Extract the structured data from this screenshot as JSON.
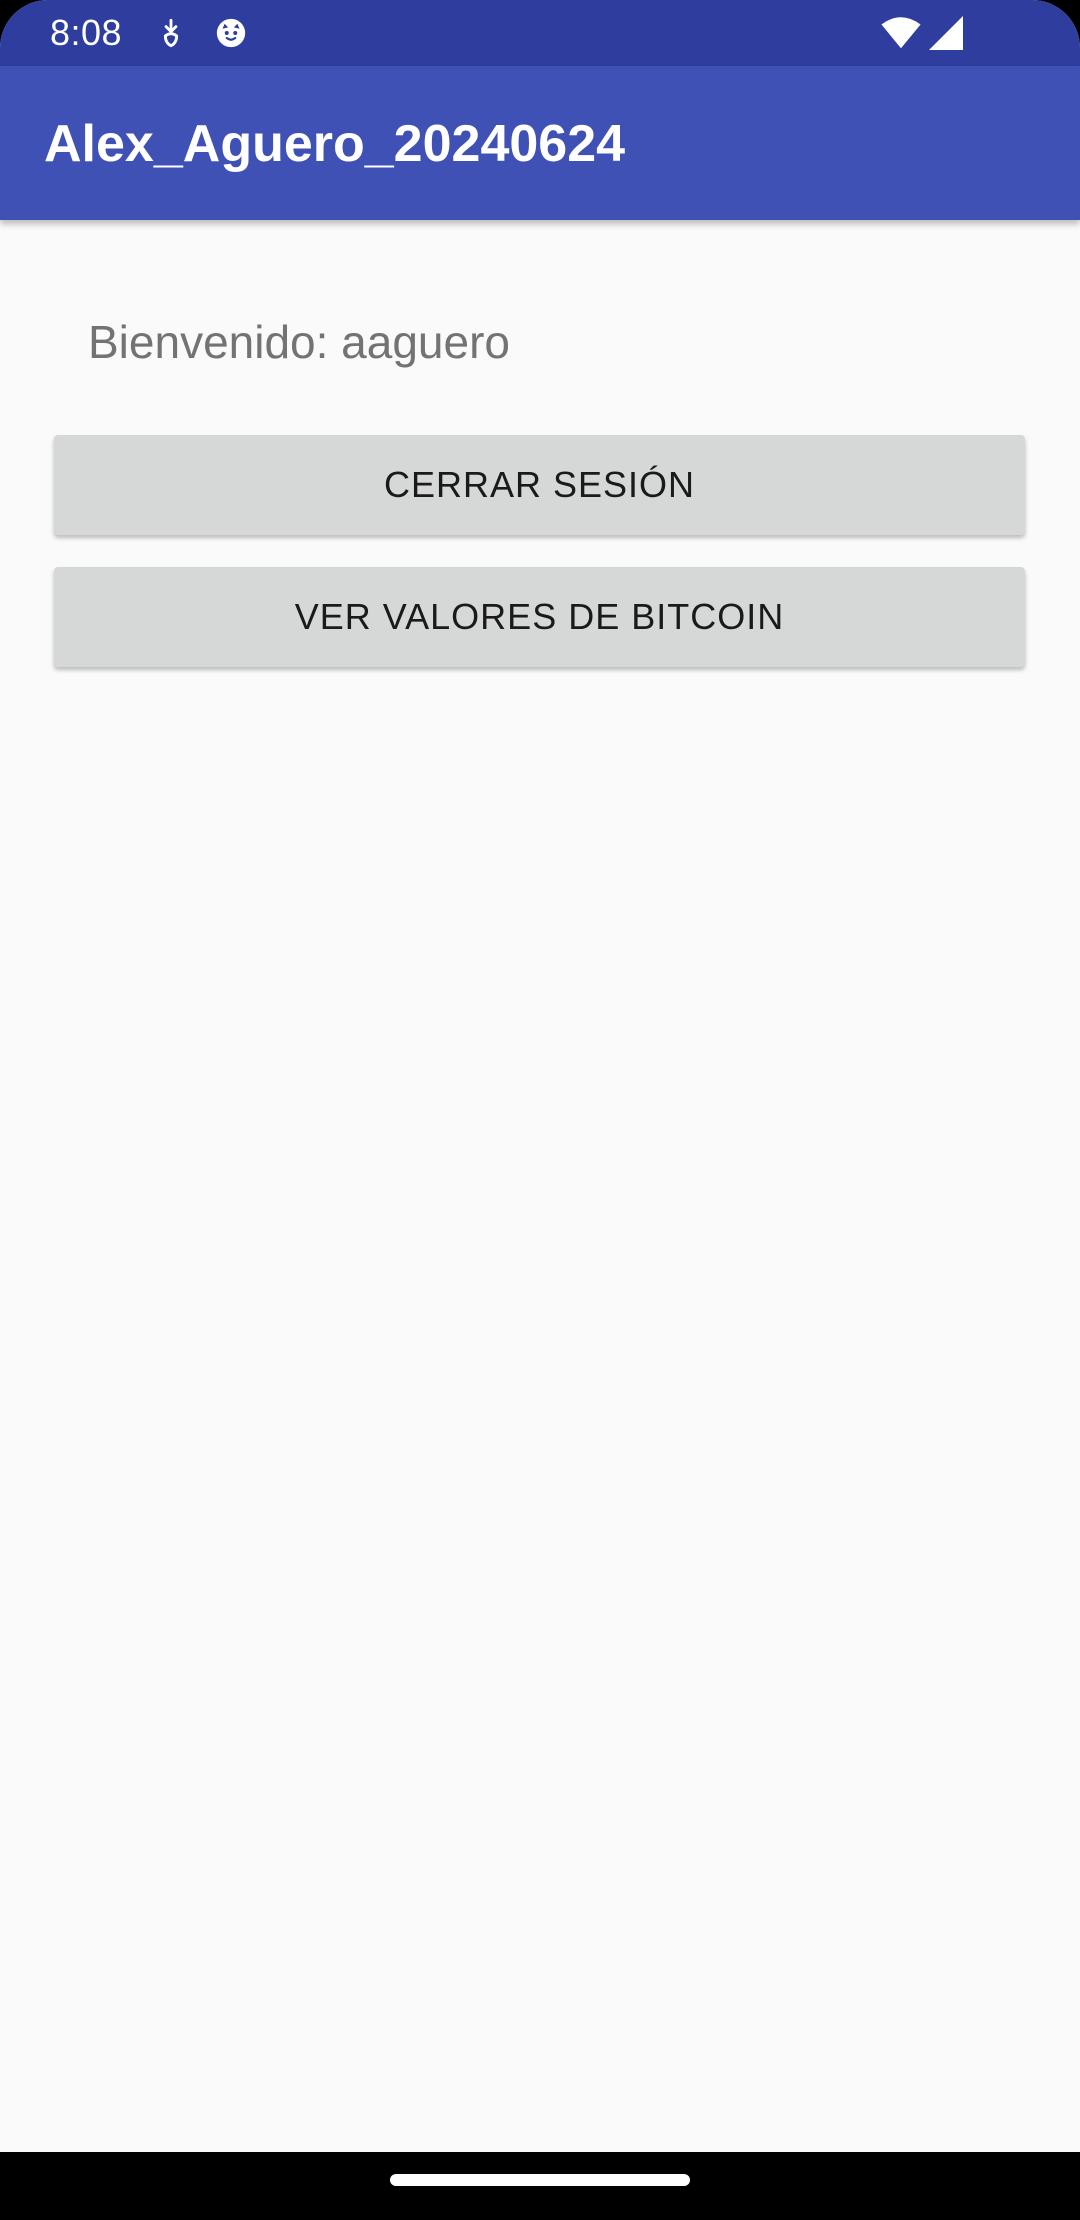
{
  "status_bar": {
    "time": "8:08",
    "left_icons": [
      "download-notification-icon",
      "cat-face-notification-icon"
    ],
    "right_icons": [
      "wifi-icon",
      "cell-signal-icon"
    ],
    "color": "#2f3e9e"
  },
  "app_bar": {
    "title": "Alex_Aguero_20240624",
    "color": "#3f51b5"
  },
  "main": {
    "welcome_text": "Bienvenido: aaguero",
    "buttons": {
      "logout_label": "CERRAR SESIÓN",
      "bitcoin_label": "VER VALORES DE BITCOIN"
    }
  },
  "nav_bar": {
    "home_handle": "home-gesture-handle"
  }
}
